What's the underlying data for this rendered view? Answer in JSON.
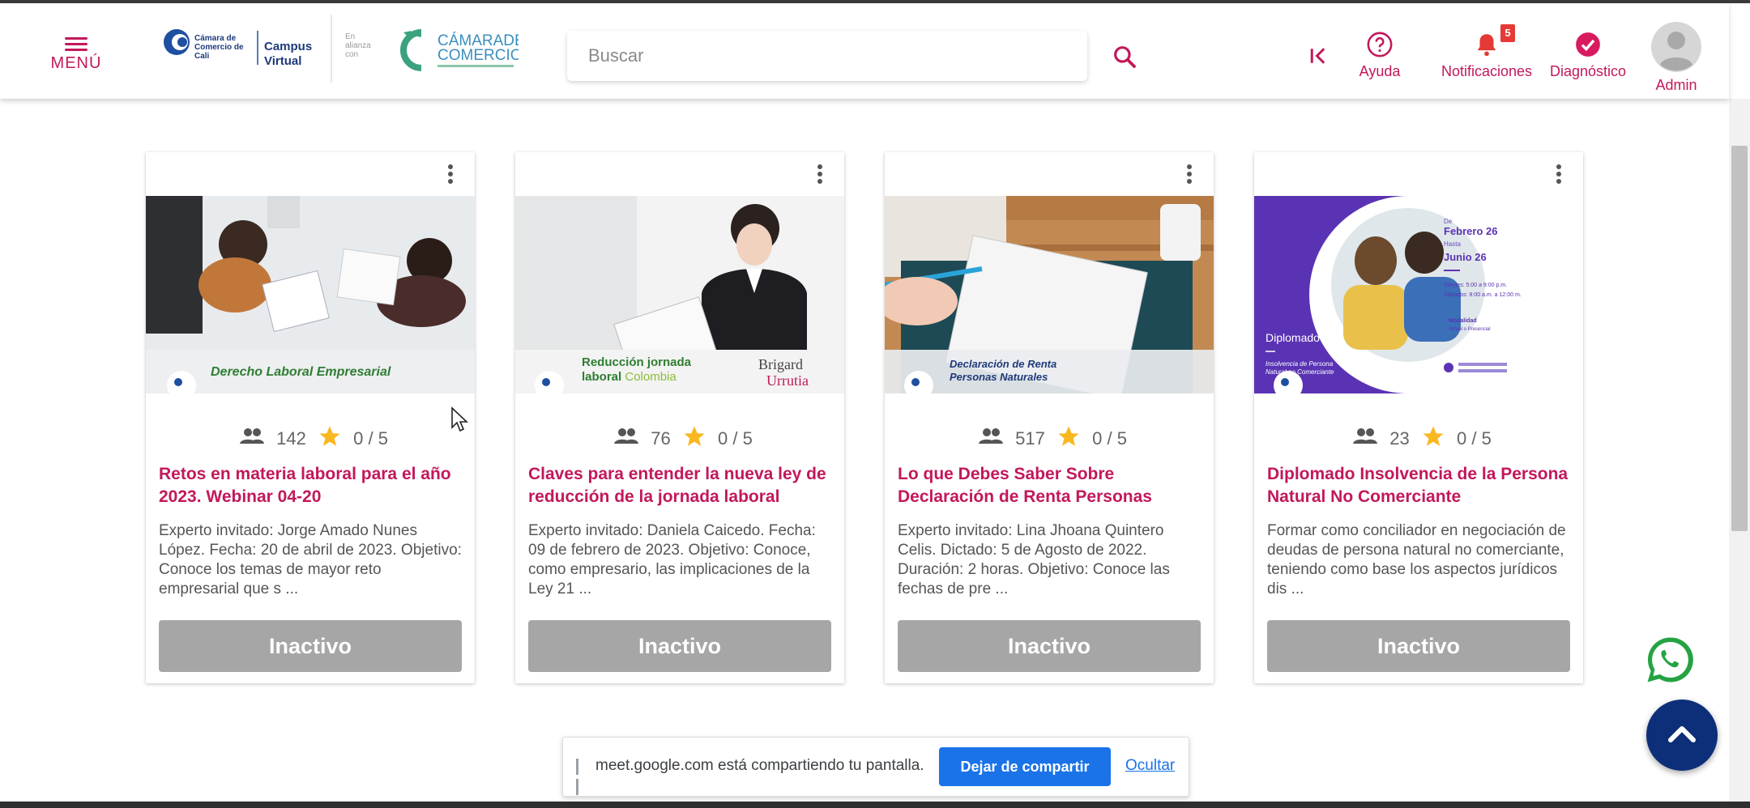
{
  "header": {
    "menu_label": "MENÚ",
    "logo_campus_lines": [
      "Cámara de",
      "Comercio de",
      "Cali"
    ],
    "logo_campus_word": [
      "Campus",
      "Virtual"
    ],
    "alianza": [
      "En",
      "alianza",
      "con"
    ],
    "logo_camara": [
      "CÁMARADE",
      "COMERCIO"
    ],
    "search_placeholder": "Buscar",
    "help_label": "Ayuda",
    "notifications_label": "Notificaciones",
    "notifications_count": "5",
    "diagnostic_label": "Diagnóstico",
    "admin_label": "Admin"
  },
  "colors": {
    "brand": "#c2185b",
    "inactive": "#a6a6a6",
    "star": "#f9b820",
    "navy": "#0d2f7a",
    "meet_blue": "#1a73e8"
  },
  "cards": [
    {
      "banner": "Derecho Laboral Empresarial",
      "participants": "142",
      "rating": "0 / 5",
      "title": "Retos en materia laboral para el año 2023. Webinar 04-20",
      "description": "Experto invitado: Jorge Amado Nunes López. Fecha: 20 de abril de 2023. Objetivo: Conoce los temas de mayor reto empresarial que s ...",
      "status": "Inactivo"
    },
    {
      "banner": "Reducción jornada laboral Colombia",
      "banner_partner": [
        "Brigard",
        "Urrutia"
      ],
      "participants": "76",
      "rating": "0 / 5",
      "title": "Claves para entender la nueva ley de reducción de la jornada laboral",
      "description": "Experto invitado: Daniela Caicedo. Fecha: 09 de febrero de 2023. Objetivo: Conoce, como empresario, las implicaciones de la Ley 21 ...",
      "status": "Inactivo"
    },
    {
      "banner": "Declaración de Renta Personas Naturales",
      "participants": "517",
      "rating": "0 / 5",
      "title": "Lo que Debes Saber Sobre Declaración de Renta Personas",
      "description": "Experto invitado: Lina Jhoana Quintero Celis. Dictado: 5 de Agosto de 2022. Duración: 2 horas. Objetivo: Conoce las fechas de pre ...",
      "status": "Inactivo"
    },
    {
      "banner": "Diplomado",
      "banner_sub": "Insolvencia de Persona Natural no Comerciante",
      "banner_dates": [
        "De",
        "Febrero 26",
        "Hasta",
        "Junio 26"
      ],
      "banner_times": [
        "Viernes: 5:00 a 9:00 p.m.",
        "Sábados: 8:00 a.m. a 12:00 m."
      ],
      "banner_mode": [
        "Modalidad",
        "Virtual o Presencial"
      ],
      "participants": "23",
      "rating": "0 / 5",
      "title": "Diplomado Insolvencia de la Persona Natural No Comerciante",
      "description": "Formar como conciliador en negociación de deudas de persona natural no comerciante, teniendo como base los aspectos jurídicos dis ...",
      "status": "Inactivo"
    }
  ],
  "share_bar": {
    "message": "meet.google.com está compartiendo tu pantalla.",
    "stop_label": "Dejar de compartir",
    "hide_label": "Ocultar"
  }
}
